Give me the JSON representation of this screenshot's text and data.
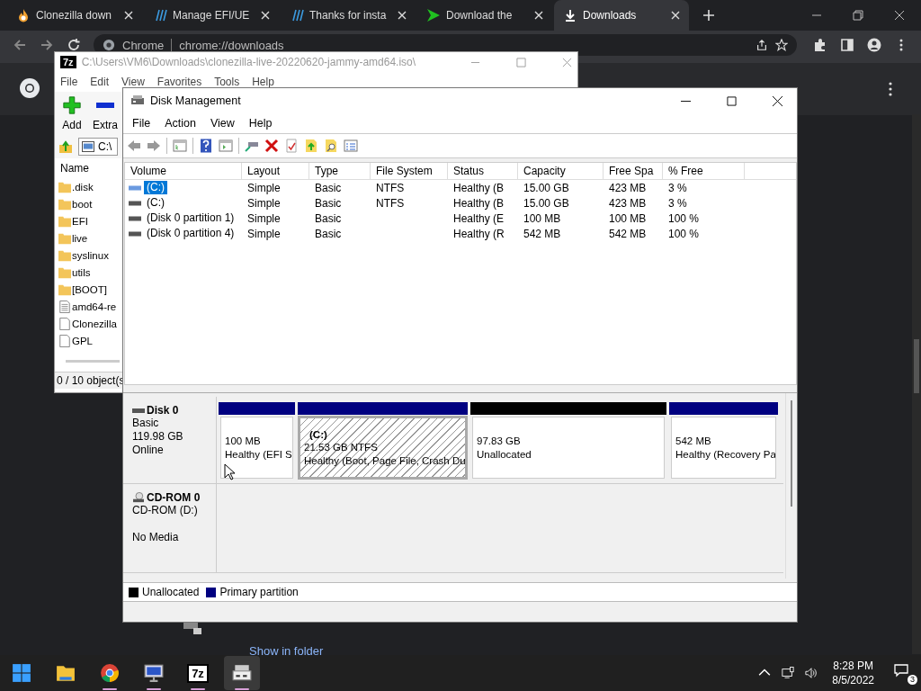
{
  "browser": {
    "tabs": [
      {
        "title": "Clonezilla down",
        "kind": "flame",
        "selected": false
      },
      {
        "title": "Manage EFI/UE",
        "kind": "slashes",
        "selected": false
      },
      {
        "title": "Thanks for insta",
        "kind": "slashes",
        "selected": false
      },
      {
        "title": "Download the",
        "kind": "arrow",
        "selected": false
      },
      {
        "title": "Downloads",
        "kind": "download",
        "selected": true
      }
    ],
    "address": {
      "label": "Chrome",
      "url": "chrome://downloads"
    }
  },
  "downloads_page": {
    "link": "Show in folder"
  },
  "sevenzip": {
    "logo": "7z",
    "title": "C:\\Users\\VM6\\Downloads\\clonezilla-live-20220620-jammy-amd64.iso\\",
    "menu": [
      "File",
      "Edit",
      "View",
      "Favorites",
      "Tools",
      "Help"
    ],
    "toolbar": [
      {
        "label": "Add",
        "kind": "add"
      },
      {
        "label": "Extra",
        "kind": "extract"
      }
    ],
    "path": "C:\\",
    "column": "Name",
    "files": [
      {
        "name": ".disk",
        "kind": "folder"
      },
      {
        "name": "boot",
        "kind": "folder"
      },
      {
        "name": "EFI",
        "kind": "folder"
      },
      {
        "name": "live",
        "kind": "folder"
      },
      {
        "name": "syslinux",
        "kind": "folder"
      },
      {
        "name": "utils",
        "kind": "folder"
      },
      {
        "name": "[BOOT]",
        "kind": "folder"
      },
      {
        "name": "amd64-re",
        "kind": "text"
      },
      {
        "name": "Clonezilla",
        "kind": "file"
      },
      {
        "name": "GPL",
        "kind": "file"
      }
    ],
    "status": "0 / 10 object(s"
  },
  "disk_management": {
    "title": "Disk Management",
    "menu": [
      "File",
      "Action",
      "View",
      "Help"
    ],
    "columns": [
      "Volume",
      "Layout",
      "Type",
      "File System",
      "Status",
      "Capacity",
      "Free Spa",
      "% Free"
    ],
    "volumes": [
      {
        "cells": [
          "(C:)",
          "Simple",
          "Basic",
          "NTFS",
          "Healthy (B",
          "15.00 GB",
          "423 MB",
          "3 %"
        ],
        "selected": true
      },
      {
        "cells": [
          "(C:)",
          "Simple",
          "Basic",
          "NTFS",
          "Healthy (B",
          "15.00 GB",
          "423 MB",
          "3 %"
        ],
        "selected": false
      },
      {
        "cells": [
          "(Disk 0 partition 1)",
          "Simple",
          "Basic",
          "",
          "Healthy (E",
          "100 MB",
          "100 MB",
          "100 %"
        ],
        "selected": false
      },
      {
        "cells": [
          "(Disk 0 partition 4)",
          "Simple",
          "Basic",
          "",
          "Healthy (R",
          "542 MB",
          "542 MB",
          "100 %"
        ],
        "selected": false
      }
    ],
    "disks": [
      {
        "kind": "disk",
        "name": "Disk 0",
        "lines": [
          "Basic",
          "119.98 GB",
          "Online"
        ],
        "partitions": [
          {
            "lines": [
              "100 MB",
              "Healthy (EFI S"
            ],
            "color": "#000080",
            "selected": false
          },
          {
            "name": "(C:)",
            "lines": [
              "21.53 GB NTFS",
              "Healthy (Boot, Page File, Crash Du"
            ],
            "color": "#000080",
            "selected": true
          },
          {
            "lines": [
              "97.83 GB",
              "Unallocated"
            ],
            "color": "#000000",
            "selected": false
          },
          {
            "lines": [
              "542 MB",
              "Healthy (Recovery Pa"
            ],
            "color": "#000080",
            "selected": false
          }
        ]
      },
      {
        "kind": "cdrom",
        "name": "CD-ROM 0",
        "lines": [
          "CD-ROM (D:)",
          "No Media"
        ]
      }
    ],
    "legend": [
      {
        "label": "Unallocated",
        "color": "#000000"
      },
      {
        "label": "Primary partition",
        "color": "#000080"
      }
    ]
  },
  "taskbar": {
    "apps": [
      {
        "kind": "start",
        "running": false,
        "active": false
      },
      {
        "kind": "folder",
        "running": false,
        "active": false
      },
      {
        "kind": "chrome",
        "running": true,
        "active": false
      },
      {
        "kind": "monitor",
        "running": true,
        "active": false
      },
      {
        "kind": "sevenzip",
        "label": "7z",
        "running": true,
        "active": false
      },
      {
        "kind": "diskmgmt",
        "running": true,
        "active": true
      }
    ],
    "time": "8:28 PM",
    "date": "8/5/2022",
    "notifications": "3"
  }
}
